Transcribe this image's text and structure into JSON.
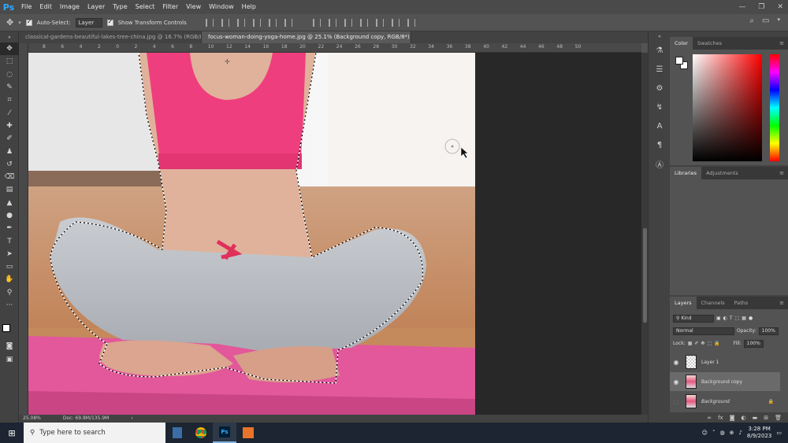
{
  "app": {
    "logo": "Ps"
  },
  "menu": [
    "File",
    "Edit",
    "Image",
    "Layer",
    "Type",
    "Select",
    "Filter",
    "View",
    "Window",
    "Help"
  ],
  "options": {
    "auto_select_label": "Auto-Select:",
    "auto_select_value": "Layer",
    "show_transform_label": "Show Transform Controls"
  },
  "tabs": [
    {
      "label": "classical-gardens-beautiful-lakes-tree-china.jpg @ 16.7% (RGB/8)",
      "active": false
    },
    {
      "label": "focus-woman-doing-yoga-home.jpg @ 25.1% (Background copy, RGB/8*) *",
      "active": true
    }
  ],
  "ruler_top": [
    "8",
    "6",
    "4",
    "2",
    "0",
    "2",
    "4",
    "6",
    "8",
    "10",
    "12",
    "14",
    "16",
    "18",
    "20",
    "22",
    "24",
    "26",
    "28",
    "30",
    "32",
    "34",
    "36",
    "38",
    "40",
    "42",
    "44",
    "46",
    "48",
    "50"
  ],
  "status": {
    "zoom": "25.08%",
    "doc": "Doc: 69.8M/135.9M"
  },
  "panels": {
    "color_tabs": [
      "Color",
      "Swatches"
    ],
    "library_tabs": [
      "Libraries",
      "Adjustments"
    ],
    "layer_tabs": [
      "Layers",
      "Channels",
      "Paths"
    ]
  },
  "layers_panel": {
    "kind": "Kind",
    "blend_mode": "Normal",
    "opacity_label": "Opacity:",
    "opacity_value": "100%",
    "lock_label": "Lock:",
    "fill_label": "Fill:",
    "fill_value": "100%",
    "layers": [
      {
        "name": "Layer 1",
        "visible": true,
        "active": false,
        "thumb": "trans"
      },
      {
        "name": "Background copy",
        "visible": true,
        "active": true,
        "thumb": "photo"
      },
      {
        "name": "Background",
        "visible": false,
        "active": false,
        "thumb": "photo"
      }
    ]
  },
  "taskbar": {
    "search_placeholder": "Type here to search",
    "time": "3:28 PM",
    "date": "8/9/2023"
  }
}
